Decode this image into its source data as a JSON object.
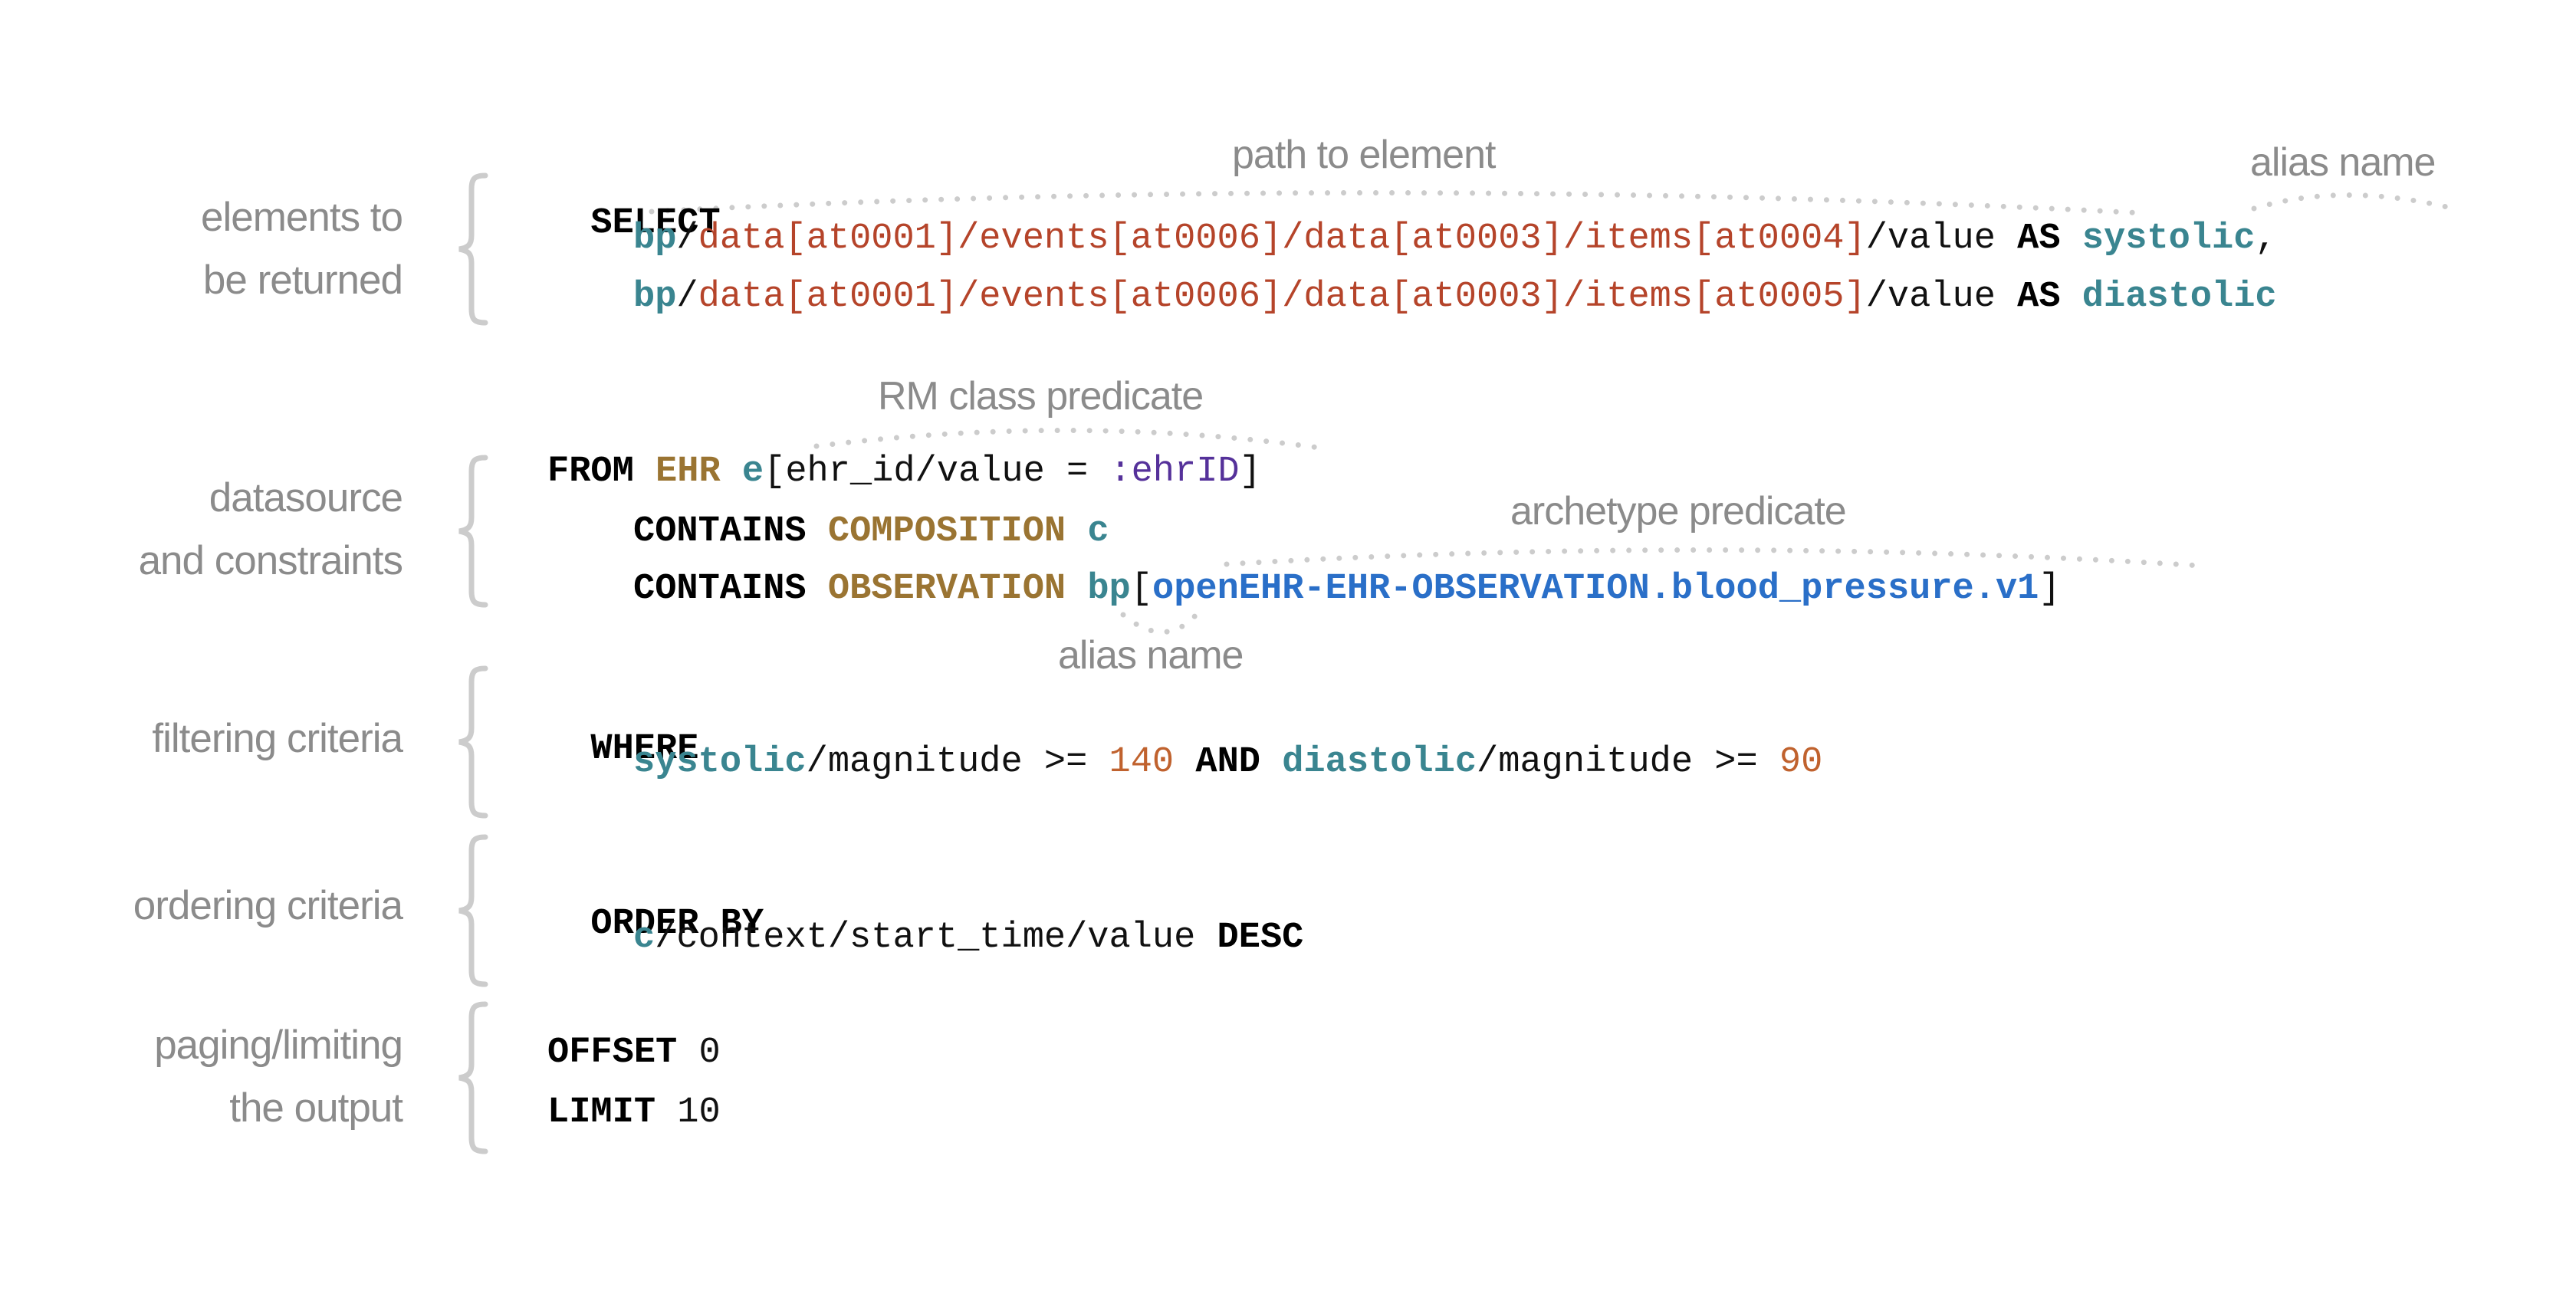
{
  "sections": [
    {
      "label_lines": [
        "elements to",
        "be returned"
      ]
    },
    {
      "label_lines": [
        "datasource",
        "and constraints"
      ]
    },
    {
      "label_lines": [
        "filtering criteria"
      ]
    },
    {
      "label_lines": [
        "ordering criteria"
      ]
    },
    {
      "label_lines": [
        "paging/limiting",
        "the output"
      ]
    }
  ],
  "annotations": {
    "path_to_element": "path to element",
    "alias_name_select": "alias name",
    "rm_class_predicate": "RM class predicate",
    "archetype_predicate": "archetype predicate",
    "alias_name_from": "alias name"
  },
  "query": {
    "select": {
      "keyword": "SELECT",
      "lines": [
        {
          "alias_var": "bp",
          "sep": "/",
          "path": "data[at0001]/events[at0006]/data[at0003]/items[at0004]",
          "suffix": "/value ",
          "as": "AS",
          "alias": "systolic",
          "trail": ","
        },
        {
          "alias_var": "bp",
          "sep": "/",
          "path": "data[at0001]/events[at0006]/data[at0003]/items[at0005]",
          "suffix": "/value ",
          "as": "AS",
          "alias": "diastolic",
          "trail": ""
        }
      ]
    },
    "from": {
      "keyword": "FROM",
      "rm_class": "EHR",
      "alias": "e",
      "predicate_open": "[ehr_id/value = ",
      "parameter": ":ehrID",
      "predicate_close": "]",
      "contains": [
        {
          "keyword": "CONTAINS",
          "rm_class": "COMPOSITION",
          "alias": "c"
        },
        {
          "keyword": "CONTAINS",
          "rm_class": "OBSERVATION",
          "alias": "bp",
          "open": "[",
          "archetype_id": "openEHR-EHR-OBSERVATION.blood_pressure.v1",
          "close": "]"
        }
      ]
    },
    "where": {
      "keyword": "WHERE",
      "left_alias": "systolic",
      "left_path": "/magnitude >= ",
      "left_value": "140",
      "operator": "AND",
      "right_alias": "diastolic",
      "right_path": "/magnitude >= ",
      "right_value": "90"
    },
    "order_by": {
      "keyword": "ORDER BY",
      "alias": "c",
      "path": "/context/start_time/value ",
      "direction": "DESC"
    },
    "paging": {
      "offset_keyword": "OFFSET",
      "offset_value": "0",
      "limit_keyword": "LIMIT",
      "limit_value": "10"
    }
  },
  "colors": {
    "keyword": "#000000",
    "alias": "#3a8590",
    "path": "#b5442a",
    "rm_class": "#9a7432",
    "parameter": "#55319a",
    "archetype_id": "#2a6fc8",
    "number": "#c0622e",
    "label": "#8b8b8b",
    "brace": "#cccccc",
    "annotation_dots": "#cccccc"
  }
}
